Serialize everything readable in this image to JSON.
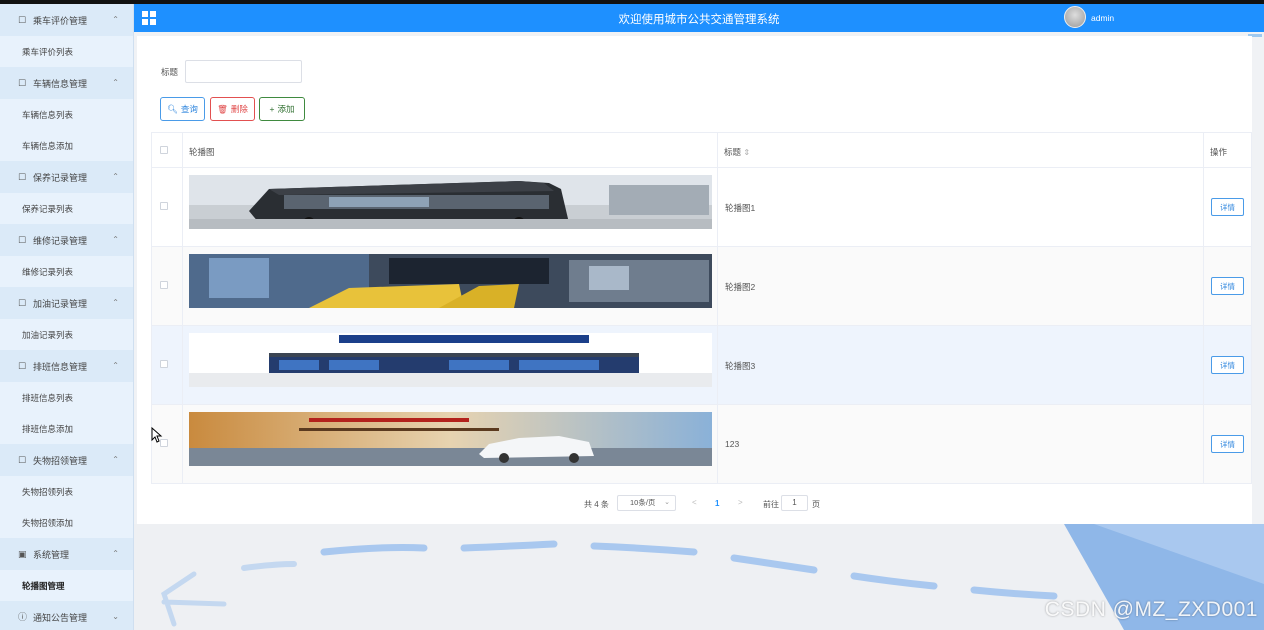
{
  "header": {
    "title": "欢迎使用城市公共交通管理系统",
    "user": "admin"
  },
  "sidebar": {
    "items": [
      {
        "kind": "group",
        "label": "乘车评价管理",
        "icon": "edit-icon",
        "chevron": "^"
      },
      {
        "kind": "item",
        "label": "乘车评价列表"
      },
      {
        "kind": "group",
        "label": "车辆信息管理",
        "icon": "edit-icon",
        "chevron": "^"
      },
      {
        "kind": "item",
        "label": "车辆信息列表"
      },
      {
        "kind": "item",
        "label": "车辆信息添加"
      },
      {
        "kind": "group",
        "label": "保养记录管理",
        "icon": "edit-icon",
        "chevron": "^"
      },
      {
        "kind": "item",
        "label": "保养记录列表"
      },
      {
        "kind": "group",
        "label": "维修记录管理",
        "icon": "edit-icon",
        "chevron": "^"
      },
      {
        "kind": "item",
        "label": "维修记录列表"
      },
      {
        "kind": "group",
        "label": "加油记录管理",
        "icon": "edit-icon",
        "chevron": "^"
      },
      {
        "kind": "item",
        "label": "加油记录列表"
      },
      {
        "kind": "group",
        "label": "排班信息管理",
        "icon": "edit-icon",
        "chevron": "^"
      },
      {
        "kind": "item",
        "label": "排班信息列表"
      },
      {
        "kind": "item",
        "label": "排班信息添加"
      },
      {
        "kind": "group",
        "label": "失物招领管理",
        "icon": "edit-icon",
        "chevron": "^"
      },
      {
        "kind": "item",
        "label": "失物招领列表"
      },
      {
        "kind": "item",
        "label": "失物招领添加"
      },
      {
        "kind": "group",
        "label": "系统管理",
        "icon": "picture-icon",
        "chevron": "^"
      },
      {
        "kind": "item",
        "label": "轮播图管理",
        "active": true
      },
      {
        "kind": "group",
        "label": "通知公告管理",
        "icon": "info-icon",
        "chevron": "v"
      }
    ]
  },
  "search": {
    "label": "标题",
    "value": ""
  },
  "toolbar": {
    "query": "查询",
    "delete": "删除",
    "add": "添加"
  },
  "table": {
    "headers": {
      "image": "轮播图",
      "title": "标题",
      "sort_icon": "⇕",
      "op": "操作"
    },
    "detail_label": "详情",
    "rows": [
      {
        "title": "轮播图1",
        "image": "bus-side-photo"
      },
      {
        "title": "轮播图2",
        "image": "bus-interior-photo"
      },
      {
        "title": "轮播图3",
        "image": "bus-stop-banner"
      },
      {
        "title": "123",
        "image": "car-ad-banner"
      }
    ]
  },
  "pagination": {
    "total": "共 4 条",
    "page_size": "10条/页",
    "prev": "<",
    "current": "1",
    "next": ">",
    "goto": "前往",
    "goto_value": "1",
    "unit": "页"
  },
  "watermark": "CSDN @MZ_ZXD001",
  "colors": {
    "header": "#1e90ff",
    "sidebar": "#e4f0fb",
    "primary": "#2f86de",
    "danger": "#e04848",
    "success": "#2f6f2f"
  }
}
